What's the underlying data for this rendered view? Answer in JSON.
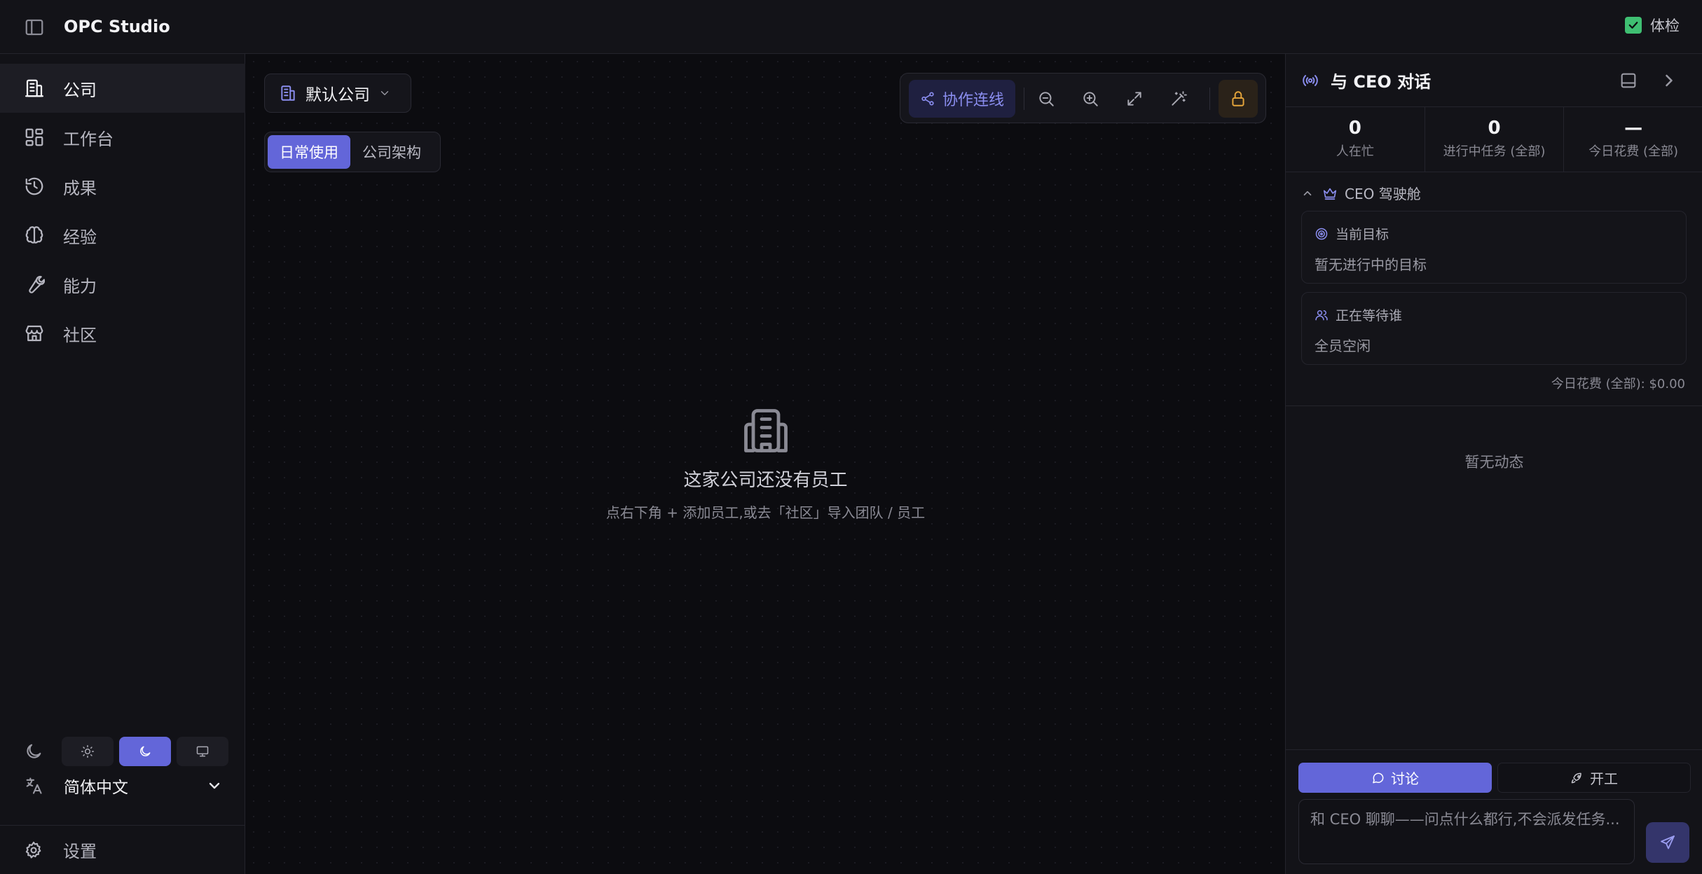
{
  "app": {
    "title": "OPC Studio"
  },
  "topbar": {
    "health_label": "体检",
    "health_checked": true
  },
  "sidebar": {
    "items": [
      {
        "label": "公司",
        "icon": "building-icon",
        "active": true
      },
      {
        "label": "工作台",
        "icon": "grid-icon",
        "active": false
      },
      {
        "label": "成果",
        "icon": "history-icon",
        "active": false
      },
      {
        "label": "经验",
        "icon": "brain-icon",
        "active": false
      },
      {
        "label": "能力",
        "icon": "wrench-icon",
        "active": false
      },
      {
        "label": "社区",
        "icon": "store-icon",
        "active": false
      }
    ],
    "theme": {
      "options": [
        "light",
        "dark",
        "system"
      ],
      "selected": "dark"
    },
    "language": "简体中文",
    "settings_label": "设置"
  },
  "main": {
    "company_select": "默认公司",
    "view_tabs": [
      {
        "label": "日常使用",
        "active": true
      },
      {
        "label": "公司架构",
        "active": false
      }
    ],
    "toolbar": {
      "collab_label": "协作连线"
    },
    "empty_state": {
      "title": "这家公司还没有员工",
      "subtitle": "点右下角 + 添加员工,或去「社区」导入团队 / 员工"
    }
  },
  "right_panel": {
    "title": "与 CEO 对话",
    "stats": [
      {
        "value": "0",
        "label": "人在忙"
      },
      {
        "value": "0",
        "label": "进行中任务 (全部)"
      },
      {
        "value": "—",
        "label": "今日花费 (全部)"
      }
    ],
    "cockpit_label": "CEO 驾驶舱",
    "current_goal": {
      "title": "当前目标",
      "body": "暂无进行中的目标"
    },
    "waiting": {
      "title": "正在等待谁",
      "body": "全员空闲"
    },
    "spend_line": "今日花费 (全部): $0.00",
    "activity_empty": "暂无动态",
    "modes": [
      {
        "label": "讨论",
        "active": true
      },
      {
        "label": "开工",
        "active": false
      }
    ],
    "chat_placeholder": "和 CEO 聊聊——问点什么都行,不会派发任务..."
  },
  "colors": {
    "accent": "#6366d9",
    "accent_text": "#8b8ef0",
    "health_green": "#3fbf72",
    "lock_amber": "#e5a53b"
  }
}
